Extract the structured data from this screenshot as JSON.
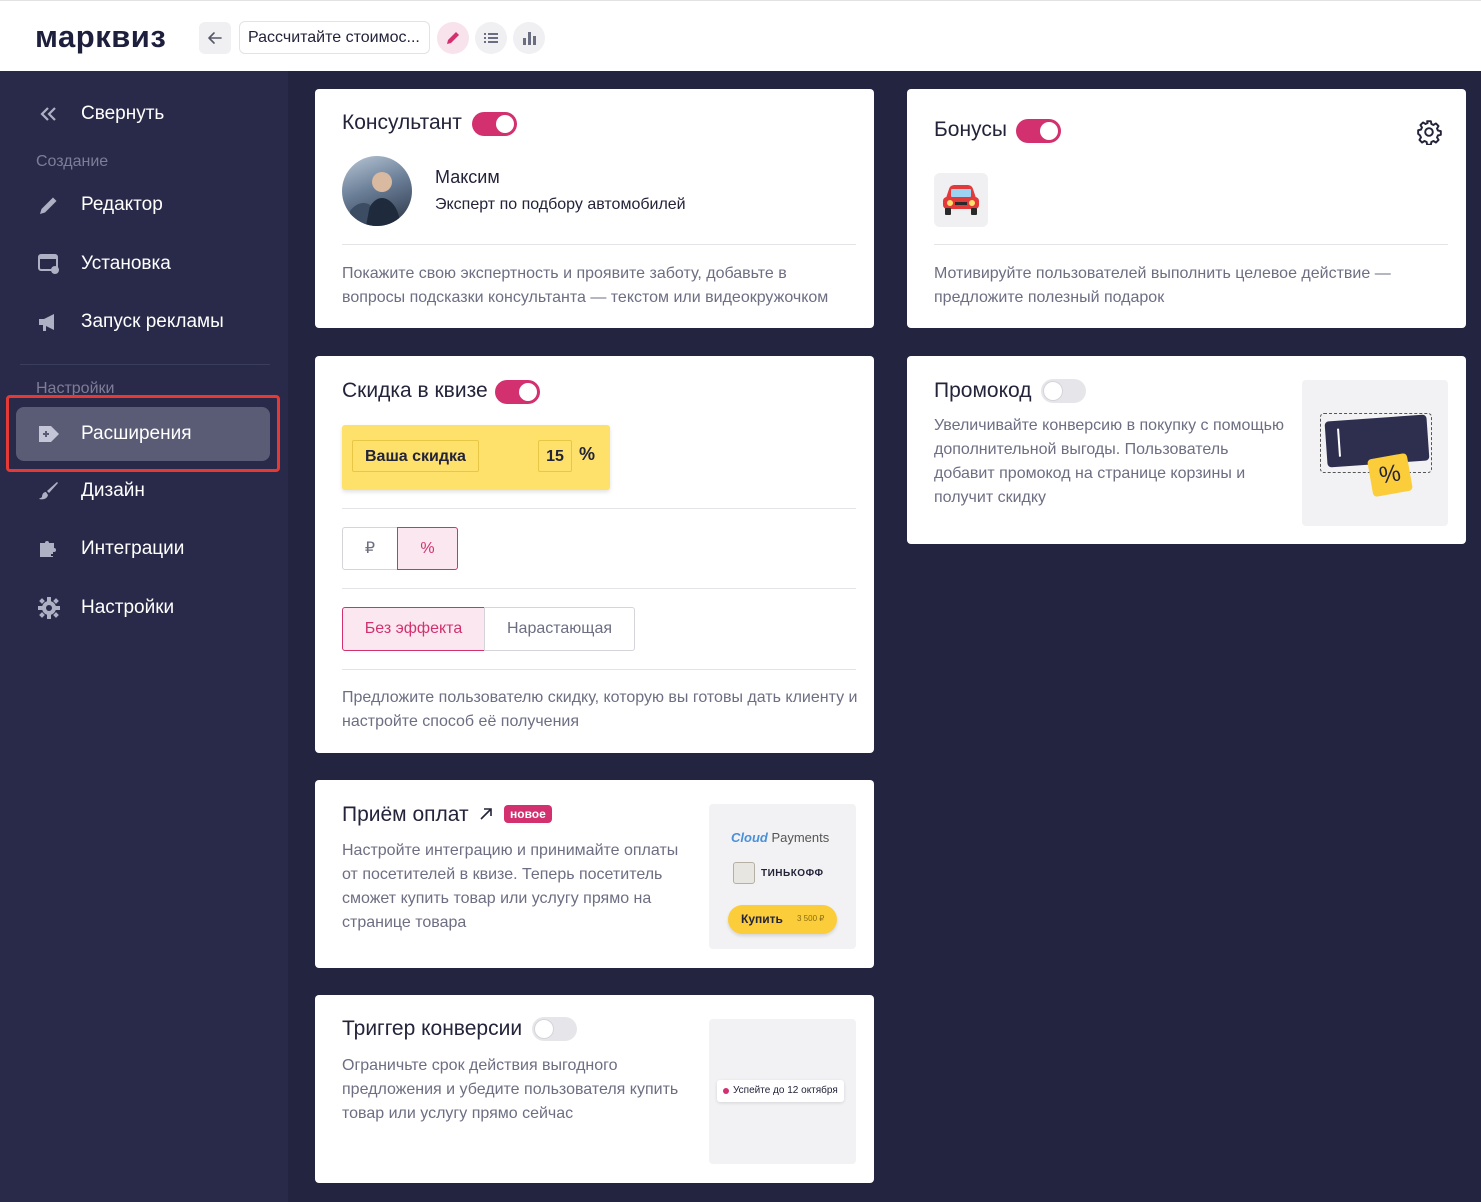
{
  "header": {
    "logo": "марквиз",
    "quiz_title": "Рассчитайте стоимос..."
  },
  "sidebar": {
    "collapse_label": "Свернуть",
    "group_create": "Создание",
    "group_settings": "Настройки",
    "items": [
      {
        "label": "Редактор",
        "icon": "pencil-icon"
      },
      {
        "label": "Установка",
        "icon": "install-icon"
      },
      {
        "label": "Запуск рекламы",
        "icon": "megaphone-icon"
      },
      {
        "label": "Расширения",
        "icon": "extension-icon",
        "active": true
      },
      {
        "label": "Дизайн",
        "icon": "brush-icon"
      },
      {
        "label": "Интеграции",
        "icon": "puzzle-icon"
      },
      {
        "label": "Настройки",
        "icon": "gear-icon"
      }
    ]
  },
  "consultant": {
    "title": "Консультант",
    "enabled": true,
    "name": "Максим",
    "role": "Эксперт по подбору автомобилей",
    "description": "Покажите свою экспертность и проявите заботу, добавьте в вопросы подсказки консультанта — текстом или видеокружочком"
  },
  "bonuses": {
    "title": "Бонусы",
    "enabled": true,
    "bonus_icon": "car-emoji",
    "description": "Мотивируйте пользователей выполнить целевое действие — предложите полезный подарок"
  },
  "discount": {
    "title": "Скидка в квизе",
    "enabled": true,
    "preview_label": "Ваша скидка",
    "preview_value": "15",
    "preview_unit": "%",
    "unit_options": [
      "₽",
      "%"
    ],
    "unit_selected": "%",
    "effect_options": [
      "Без эффекта",
      "Нарастающая"
    ],
    "effect_selected": "Без эффекта",
    "description": "Предложите пользователю скидку, которую вы готовы дать клиенту и настройте способ её получения"
  },
  "promocode": {
    "title": "Промокод",
    "enabled": false,
    "description": "Увеличивайте конверсию в покупку с помощью дополнительной выгоды. Пользователь добавит промокод на странице корзины и получит скидку",
    "ill_symbol": "%"
  },
  "payments": {
    "title": "Приём оплат",
    "badge": "новое",
    "description": "Настройте интеграцию и принимайте оплаты от посетителей в квизе. Теперь посетитель сможет купить товар или услугу прямо на странице товара",
    "ill_brand1_a": "Cloud",
    "ill_brand1_b": "Payments",
    "ill_brand2": "ТИНЬКОФФ",
    "ill_button": "Купить",
    "ill_price": "3 500 ₽"
  },
  "trigger": {
    "title": "Триггер конверсии",
    "enabled": false,
    "description": "Ограничьте срок действия выгодного предложения и убедите пользователя купить товар или услугу прямо сейчас",
    "ill_chip": "Успейте до 12 октября"
  },
  "colors": {
    "accent": "#d2306f",
    "sidebar_bg": "#292a49",
    "main_bg": "#23243f",
    "discount_yellow": "#fde16a"
  }
}
